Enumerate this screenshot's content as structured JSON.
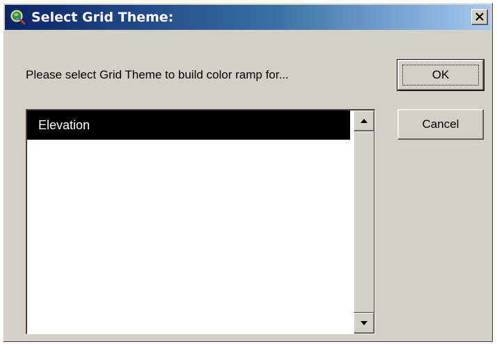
{
  "window": {
    "title": "Select Grid Theme:",
    "close_label": "close"
  },
  "prompt": "Please select Grid Theme to build color ramp for...",
  "buttons": {
    "ok": "OK",
    "cancel": "Cancel"
  },
  "list": {
    "items": [
      "Elevation"
    ],
    "selected": "Elevation"
  },
  "icons": {
    "app": "globe-magnifier-icon",
    "close": "close-icon",
    "scroll_up": "scroll-up-arrow-icon",
    "scroll_down": "scroll-down-arrow-icon"
  },
  "colors": {
    "title_start": "#0a246a",
    "title_end": "#a6caf0",
    "face": "#d4d0c8",
    "selection": "#000000"
  }
}
